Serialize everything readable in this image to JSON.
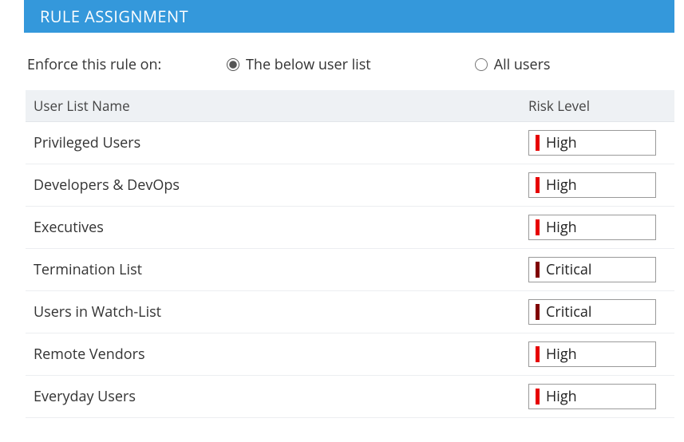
{
  "header": {
    "title": "RULE ASSIGNMENT"
  },
  "enforce": {
    "label": "Enforce this rule on:",
    "options": {
      "below": "The below user list",
      "all": "All users"
    },
    "selected": "below"
  },
  "table": {
    "columns": {
      "name": "User List Name",
      "risk": "Risk Level"
    },
    "rows": [
      {
        "name": "Privileged Users",
        "risk_level": "High",
        "risk_color": "#e60000"
      },
      {
        "name": "Developers & DevOps",
        "risk_level": "High",
        "risk_color": "#e60000"
      },
      {
        "name": "Executives",
        "risk_level": "High",
        "risk_color": "#e60000"
      },
      {
        "name": "Termination List",
        "risk_level": "Critical",
        "risk_color": "#800000"
      },
      {
        "name": "Users in Watch-List",
        "risk_level": "Critical",
        "risk_color": "#800000"
      },
      {
        "name": "Remote Vendors",
        "risk_level": "High",
        "risk_color": "#e60000"
      },
      {
        "name": "Everyday Users",
        "risk_level": "High",
        "risk_color": "#e60000"
      }
    ]
  }
}
